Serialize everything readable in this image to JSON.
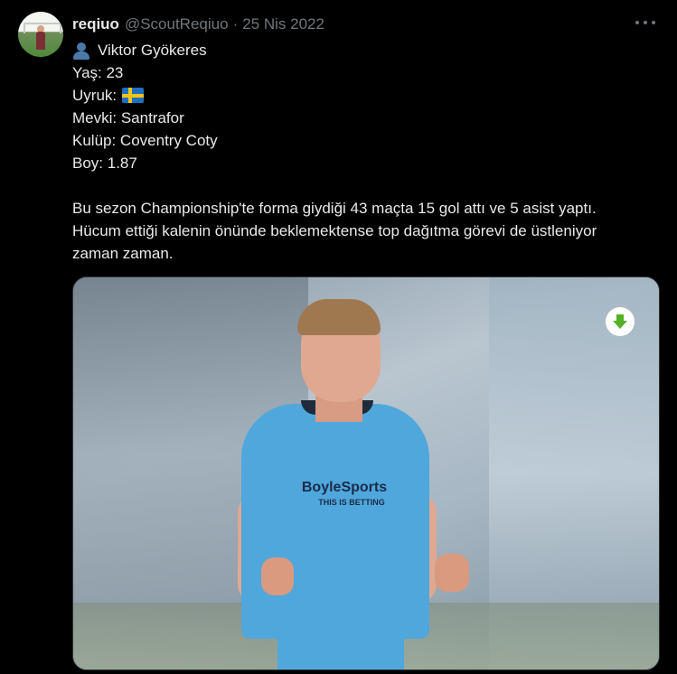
{
  "tweet": {
    "author_name": "reqiuo",
    "author_handle": "@ScoutReqiuo",
    "separator": "·",
    "date": "25 Nis 2022",
    "lines": [
      "Viktor Gyökeres",
      "Yaş: 23",
      "Uyruk:",
      "Mevki: Santrafor",
      "Kulüp: Coventry Coty",
      "Boy: 1.87"
    ],
    "paragraph": [
      "Bu sezon Championship'te forma giydiği 43 maçta 15 gol attı ve 5 asist yaptı.",
      "Hücum ettiği kalenin önünde beklemektense top dağıtma görevi de üstleniyor",
      "zaman zaman."
    ]
  },
  "media": {
    "shirt_sponsor": "BoyleSports",
    "shirt_sponsor_sub": "THIS IS BETTING"
  },
  "icons": {
    "more": "more-icon",
    "person": "person-icon",
    "flag": "sweden-flag-icon",
    "download": "download-arrow-icon"
  },
  "colors": {
    "background": "#000000",
    "primary_text": "#e7e9ea",
    "secondary_text": "#71767b",
    "download_arrow": "#57b025"
  }
}
